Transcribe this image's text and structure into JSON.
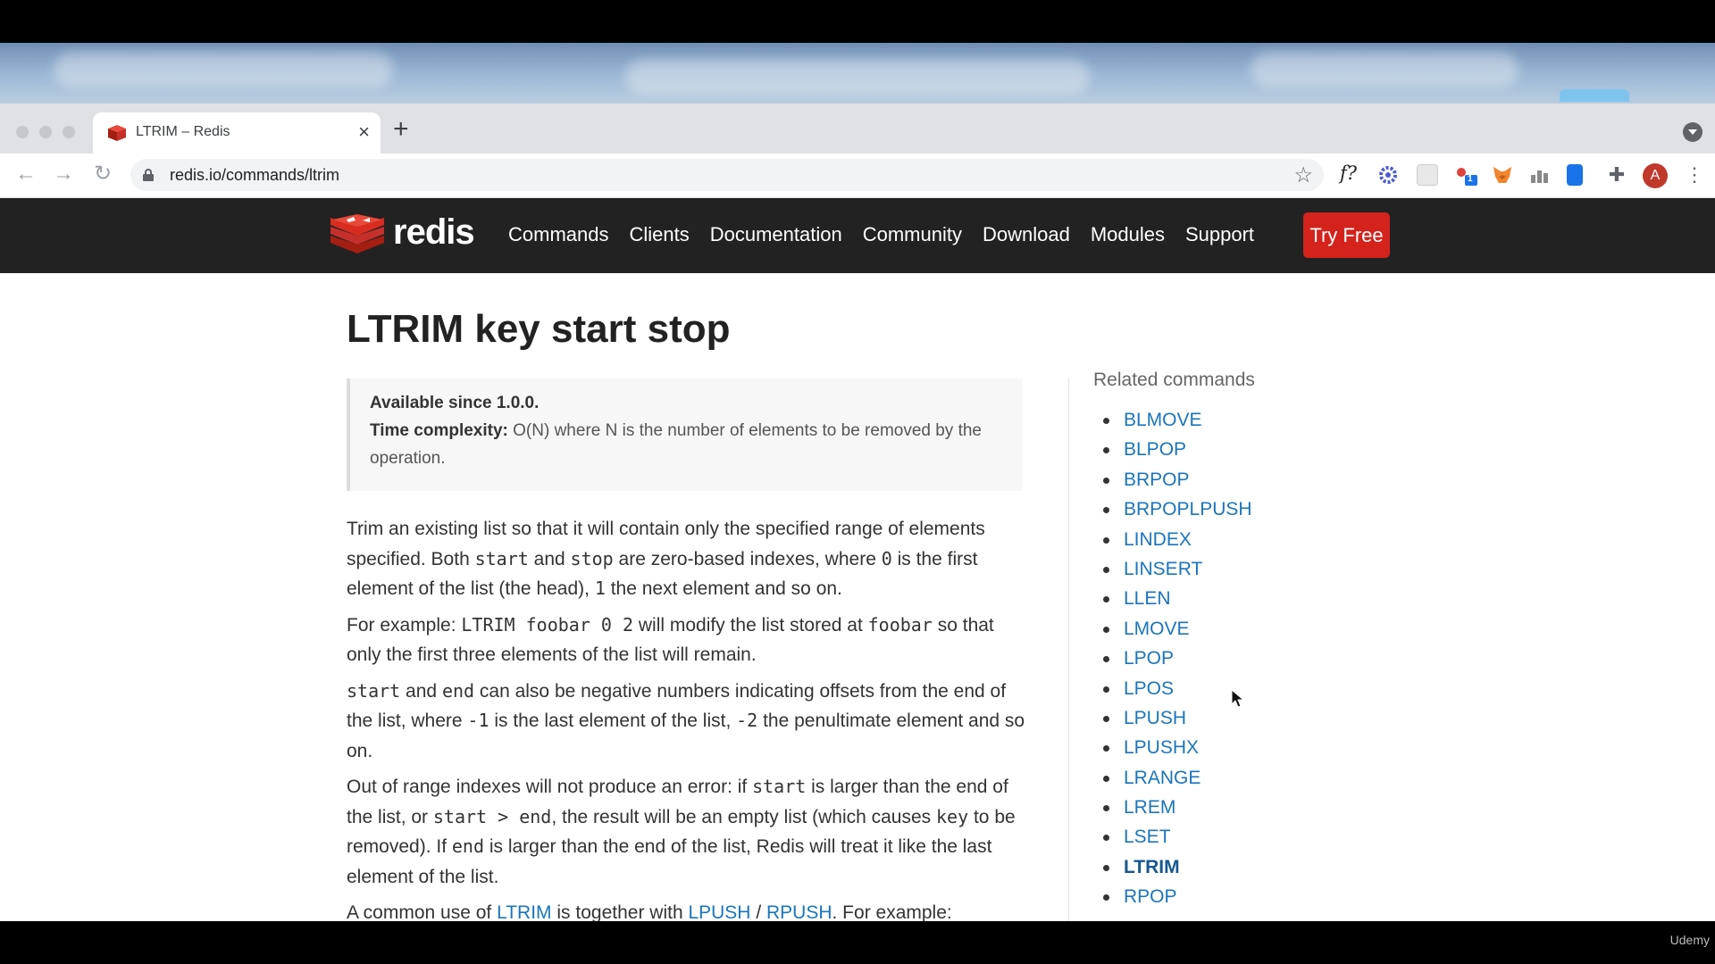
{
  "browser": {
    "tab_title": "LTRIM – Redis",
    "new_tab_label": "+",
    "close_label": "×",
    "url": "redis.io/commands/ltrim",
    "profile_initial": "A",
    "ext_fx_label": "f?",
    "ext_badge": "1"
  },
  "site": {
    "logo_text": "redis",
    "nav": [
      "Commands",
      "Clients",
      "Documentation",
      "Community",
      "Download",
      "Modules",
      "Support"
    ],
    "cta": "Try Free",
    "brand_color": "#d3231c"
  },
  "page": {
    "title": "LTRIM key start stop",
    "available_label": "Available since 1.0.0.",
    "time_label": "Time complexity:",
    "time_text": "O(N) where N is the number of elements to be removed by the operation.",
    "p1": [
      "Trim an existing list so that it will contain only the specified range of elements specified. Both ",
      "start",
      " and ",
      "stop",
      " are zero-based indexes, where ",
      "0",
      " is the first element of the list (the head), ",
      "1",
      " the next element and so on."
    ],
    "p2": [
      "For example: ",
      "LTRIM foobar 0 2",
      " will modify the list stored at ",
      "foobar",
      " so that only the first three elements of the list will remain."
    ],
    "p3": [
      "start",
      " and ",
      "end",
      " can also be negative numbers indicating offsets from the end of the list, where ",
      "-1",
      " is the last element of the list, ",
      "-2",
      " the penultimate element and so on."
    ],
    "p4": [
      "Out of range indexes will not produce an error: if ",
      "start",
      " is larger than the end of the list, or ",
      "start > end",
      ", the result will be an empty list (which causes ",
      "key",
      " to be removed). If ",
      "end",
      " is larger than the end of the list, Redis will treat it like the last element of the list."
    ],
    "p5": [
      "A common use of ",
      "LTRIM",
      " is together with ",
      "LPUSH",
      " / ",
      "RPUSH",
      ". For example:"
    ]
  },
  "related": {
    "title": "Related commands",
    "items": [
      "BLMOVE",
      "BLPOP",
      "BRPOP",
      "BRPOPLPUSH",
      "LINDEX",
      "LINSERT",
      "LLEN",
      "LMOVE",
      "LPOP",
      "LPOS",
      "LPUSH",
      "LPUSHX",
      "LRANGE",
      "LREM",
      "LSET",
      "LTRIM",
      "RPOP"
    ],
    "current": "LTRIM"
  },
  "watermark": "Udemy"
}
